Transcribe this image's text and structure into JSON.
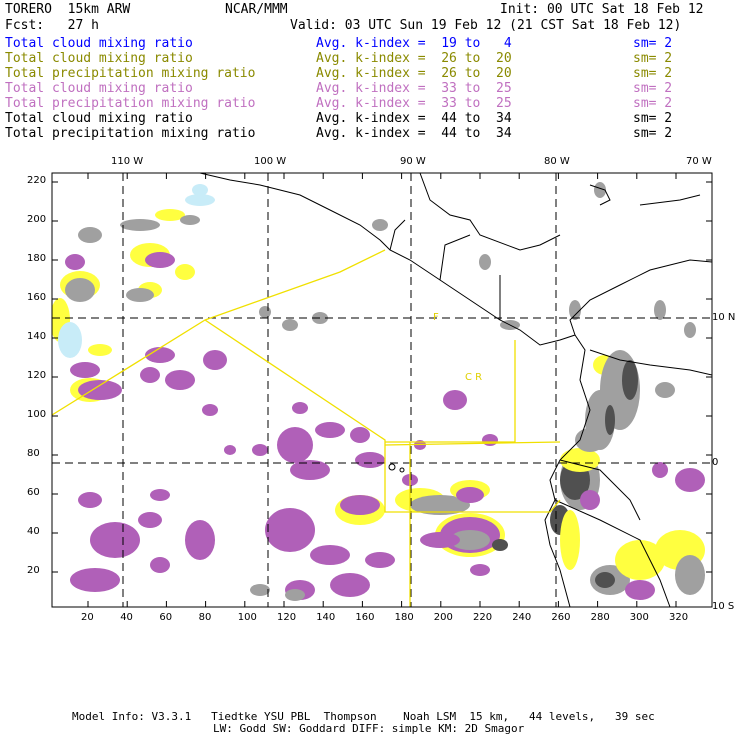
{
  "header": {
    "model": "TORERO  15km ARW",
    "org": "NCAR/MMM",
    "init": "Init: 00 UTC Sat 18 Feb 12",
    "fcst": "Fcst:   27 h",
    "valid": "Valid: 03 UTC Sun 19 Feb 12 (21 CST Sat 18 Feb 12)"
  },
  "legend": [
    {
      "field": "Total cloud mixing ratio",
      "range": "Avg. k-index =  19 to   4",
      "sm": "sm= 2",
      "color": "#0000ff"
    },
    {
      "field": "Total cloud mixing ratio",
      "range": "Avg. k-index =  26 to  20",
      "sm": "sm= 2",
      "color": "#8a8a00"
    },
    {
      "field": "Total precipitation mixing ratio",
      "range": "Avg. k-index =  26 to  20",
      "sm": "sm= 2",
      "color": "#8a8a00"
    },
    {
      "field": "Total cloud mixing ratio",
      "range": "Avg. k-index =  33 to  25",
      "sm": "sm= 2",
      "color": "#c070c0"
    },
    {
      "field": "Total precipitation mixing ratio",
      "range": "Avg. k-index =  33 to  25",
      "sm": "sm= 2",
      "color": "#c070c0"
    },
    {
      "field": "Total cloud mixing ratio",
      "range": "Avg. k-index =  44 to  34",
      "sm": "sm= 2",
      "color": "#000000"
    },
    {
      "field": "Total precipitation mixing ratio",
      "range": "Avg. k-index =  44 to  34",
      "sm": "sm= 2",
      "color": "#000000"
    }
  ],
  "map": {
    "lon_labels": [
      "110 W",
      "100 W",
      "90 W",
      "80 W",
      "70 W"
    ],
    "lat_labels": [
      "10 N",
      "0",
      "10 S"
    ],
    "x_ticks": [
      "20",
      "40",
      "60",
      "80",
      "100",
      "120",
      "140",
      "160",
      "180",
      "200",
      "220",
      "240",
      "260",
      "280",
      "300",
      "320"
    ],
    "y_ticks": [
      "220",
      "200",
      "180",
      "160",
      "140",
      "120",
      "100",
      "80",
      "60",
      "40",
      "20"
    ],
    "box_labels": [
      "F",
      "C R"
    ]
  },
  "footer": {
    "line1": "Model Info: V3.3.1   Tiedtke YSU PBL  Thompson    Noah LSM  15 km,   44 levels,   39 sec",
    "line2": "LW: Godd SW: Goddard DIFF: simple KM: 2D Smagor"
  }
}
